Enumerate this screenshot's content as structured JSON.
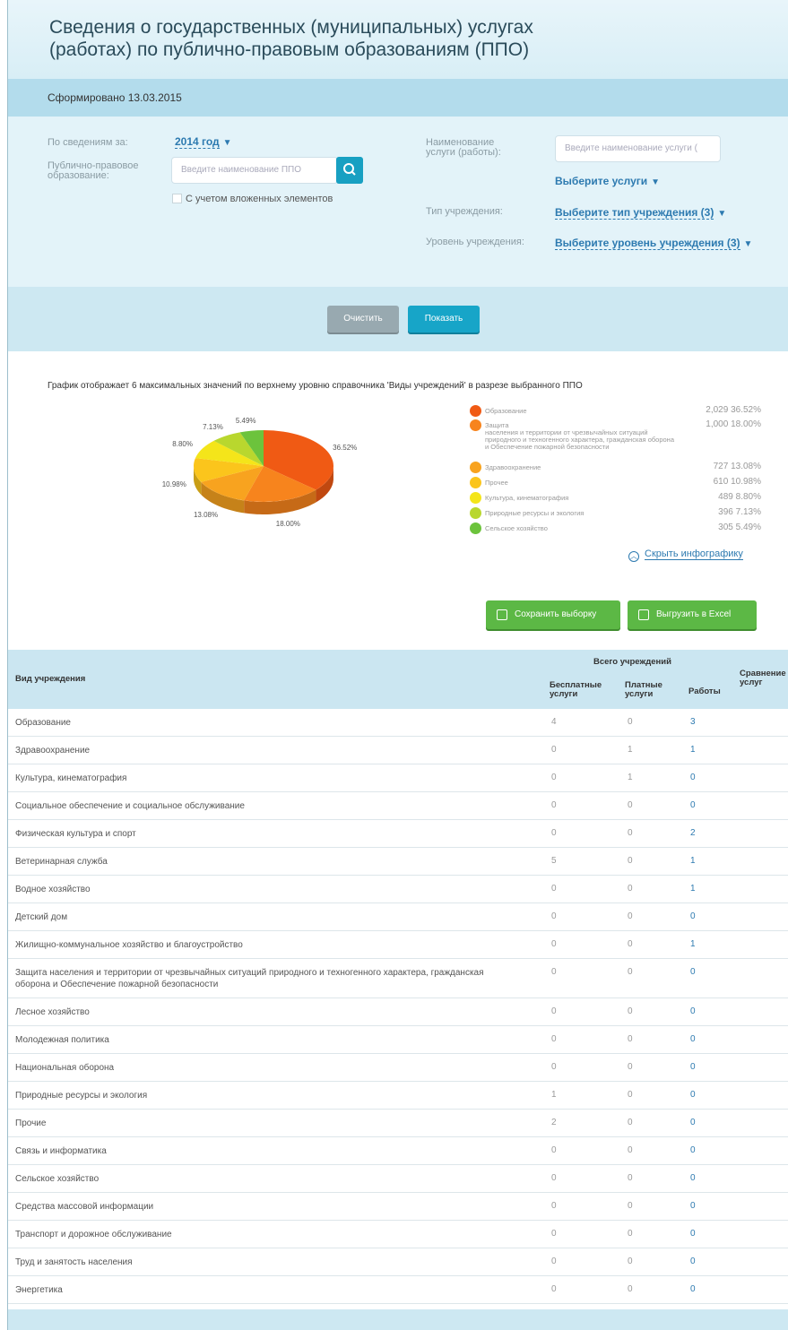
{
  "header": {
    "title_line1": "Сведения о государственных (муниципальных) услугах",
    "title_line2": "(работах) по публично-правовым образованиям (ППО)"
  },
  "formed": {
    "text": "Сформировано 13.03.2015"
  },
  "filters": {
    "period_label": "По сведениям за:",
    "period_value": "2014 год",
    "ppo_label": "Публично-правовое образование:",
    "ppo_placeholder": "Введите наименование ППО",
    "nested_label": "С учетом вложенных элементов",
    "service_name_label": "Наименование услуги (работы):",
    "service_placeholder": "Введите наименование услуги (",
    "choose_services": "Выберите услуги",
    "institution_type_label": "Тип учреждения:",
    "institution_type_value": "Выберите тип учреждения (3)",
    "institution_level_label": "Уровень учреждения:",
    "institution_level_value": "Выберите уровень учреждения (3)"
  },
  "actions": {
    "clear": "Очистить",
    "show": "Показать"
  },
  "chart_caption": "График отображает 6 максимальных значений по верхнему уровню справочника 'Виды учреждений' в разрезе выбранного ППО",
  "chart_data": {
    "type": "pie",
    "slices": [
      {
        "name": "Образование",
        "count": "2,029",
        "percent": 36.52,
        "label": "36.52%",
        "color": "#f05a14"
      },
      {
        "name": "Защита населения и территории от чрезвычайных ситуаций природного и техногенного характера, гражданская оборона и Обеспечение пожарной безопасности",
        "count": "1,000",
        "percent": 18.0,
        "label": "18.00%",
        "color": "#f7841d"
      },
      {
        "name": "Здравоохранение",
        "count": "727",
        "percent": 13.08,
        "label": "13.08%",
        "color": "#f8a31f"
      },
      {
        "name": "Прочее",
        "count": "610",
        "percent": 10.98,
        "label": "10.98%",
        "color": "#fbc51c"
      },
      {
        "name": "Культура, кинематография",
        "count": "489",
        "percent": 8.8,
        "label": "8.80%",
        "color": "#f4e51a"
      },
      {
        "name": "Природные ресурсы и экология",
        "count": "396",
        "percent": 7.13,
        "label": "7.13%",
        "color": "#b9d72e"
      },
      {
        "name": "Сельское хозяйство",
        "count": "305",
        "percent": 5.49,
        "label": "5.49%",
        "color": "#6cc33c"
      }
    ]
  },
  "legend": [
    {
      "name": "Образование",
      "value": "2,029 36.52%",
      "color": "#f05a14"
    },
    {
      "name_lines": [
        "Защита",
        "населения и территории от чрезвычайных ситуаций",
        "природного и техногенного характера, гражданская оборона",
        "и Обеспечение пожарной безопасности"
      ],
      "value": "1,000 18.00%",
      "color": "#f7841d"
    },
    {
      "name": "Здравоохранение",
      "value": "727 13.08%",
      "color": "#f8a31f"
    },
    {
      "name": "Прочее",
      "value": "610 10.98%",
      "color": "#fbc51c"
    },
    {
      "name": "Культура, кинематография",
      "value": "489 8.80%",
      "color": "#f4e51a"
    },
    {
      "name": "Природные ресурсы и экология",
      "value": "396 7.13%",
      "color": "#b9d72e"
    },
    {
      "name": "Сельское хозяйство",
      "value": "305 5.49%",
      "color": "#6cc33c"
    }
  ],
  "infographic_toggle": "Скрыть инфографику",
  "export": {
    "save": "Сохранить выборку",
    "excel": "Выгрузить в Excel"
  },
  "table": {
    "col_type": "Вид учреждения",
    "group_total": "Всего учреждений",
    "col_free": "Бесплатные услуги",
    "col_paid": "Платные услуги",
    "col_works": "Работы",
    "col_compare": "Сравнение услуг",
    "rows": [
      {
        "name": "Образование",
        "free": "4",
        "paid": "0",
        "works": "3"
      },
      {
        "name": "Здравоохранение",
        "free": "0",
        "paid": "1",
        "works": "1"
      },
      {
        "name": "Культура, кинематография",
        "free": "0",
        "paid": "1",
        "works": "0"
      },
      {
        "name": "Социальное обеспечение и социальное обслуживание",
        "free": "0",
        "paid": "0",
        "works": "0"
      },
      {
        "name": "Физическая культура и спорт",
        "free": "0",
        "paid": "0",
        "works": "2"
      },
      {
        "name": "Ветеринарная служба",
        "free": "5",
        "paid": "0",
        "works": "1"
      },
      {
        "name": "Водное хозяйство",
        "free": "0",
        "paid": "0",
        "works": "1"
      },
      {
        "name": "Детский дом",
        "free": "0",
        "paid": "0",
        "works": "0"
      },
      {
        "name": "Жилищно-коммунальное хозяйство и благоустройство",
        "free": "0",
        "paid": "0",
        "works": "1"
      },
      {
        "name": "Защита населения и территории от чрезвычайных ситуаций природного и техногенного характера, гражданская оборона и Обеспечение пожарной безопасности",
        "free": "0",
        "paid": "0",
        "works": "0"
      },
      {
        "name": "Лесное хозяйство",
        "free": "0",
        "paid": "0",
        "works": "0"
      },
      {
        "name": "Молодежная политика",
        "free": "0",
        "paid": "0",
        "works": "0"
      },
      {
        "name": "Национальная оборона",
        "free": "0",
        "paid": "0",
        "works": "0"
      },
      {
        "name": "Природные ресурсы и экология",
        "free": "1",
        "paid": "0",
        "works": "0"
      },
      {
        "name": "Прочие",
        "free": "2",
        "paid": "0",
        "works": "0"
      },
      {
        "name": "Связь и информатика",
        "free": "0",
        "paid": "0",
        "works": "0"
      },
      {
        "name": "Сельское хозяйство",
        "free": "0",
        "paid": "0",
        "works": "0"
      },
      {
        "name": "Средства массовой информации",
        "free": "0",
        "paid": "0",
        "works": "0"
      },
      {
        "name": "Транспорт и дорожное обслуживание",
        "free": "0",
        "paid": "0",
        "works": "0"
      },
      {
        "name": "Труд и занятость населения",
        "free": "0",
        "paid": "0",
        "works": "0"
      },
      {
        "name": "Энергетика",
        "free": "0",
        "paid": "0",
        "works": "0"
      }
    ]
  }
}
